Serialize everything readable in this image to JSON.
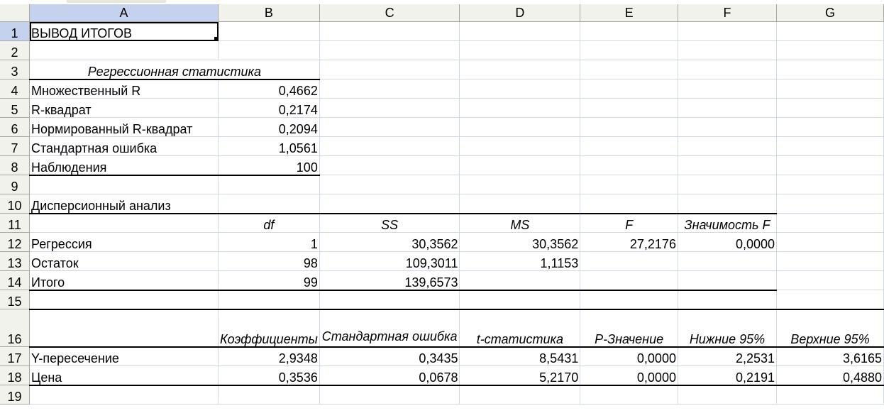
{
  "columns": [
    "A",
    "B",
    "C",
    "D",
    "E",
    "F",
    "G"
  ],
  "rows": [
    {
      "num": "1",
      "cells": [
        "ВЫВОД ИТОГОВ",
        "",
        "",
        "",
        "",
        "",
        ""
      ]
    },
    {
      "num": "2",
      "cells": [
        "",
        "",
        "",
        "",
        "",
        "",
        ""
      ]
    },
    {
      "num": "3",
      "cells": [
        "Регрессионная статистика",
        "",
        "",
        "",
        "",
        "",
        ""
      ]
    },
    {
      "num": "4",
      "cells": [
        "Множественный R",
        "0,4662",
        "",
        "",
        "",
        "",
        ""
      ]
    },
    {
      "num": "5",
      "cells": [
        "R-квадрат",
        "0,2174",
        "",
        "",
        "",
        "",
        ""
      ]
    },
    {
      "num": "6",
      "cells": [
        "Нормированный R-квадрат",
        "0,2094",
        "",
        "",
        "",
        "",
        ""
      ]
    },
    {
      "num": "7",
      "cells": [
        "Стандартная ошибка",
        "1,0561",
        "",
        "",
        "",
        "",
        ""
      ]
    },
    {
      "num": "8",
      "cells": [
        "Наблюдения",
        "100",
        "",
        "",
        "",
        "",
        ""
      ]
    },
    {
      "num": "9",
      "cells": [
        "",
        "",
        "",
        "",
        "",
        "",
        ""
      ]
    },
    {
      "num": "10",
      "cells": [
        "Дисперсионный анализ",
        "",
        "",
        "",
        "",
        "",
        ""
      ]
    },
    {
      "num": "11",
      "cells": [
        "",
        "df",
        "SS",
        "MS",
        "F",
        "Значимость F",
        ""
      ]
    },
    {
      "num": "12",
      "cells": [
        "Регрессия",
        "1",
        "30,3562",
        "30,3562",
        "27,2176",
        "0,0000",
        ""
      ]
    },
    {
      "num": "13",
      "cells": [
        "Остаток",
        "98",
        "109,3011",
        "1,1153",
        "",
        "",
        ""
      ]
    },
    {
      "num": "14",
      "cells": [
        "Итого",
        "99",
        "139,6573",
        "",
        "",
        "",
        ""
      ]
    },
    {
      "num": "15",
      "cells": [
        "",
        "",
        "",
        "",
        "",
        "",
        ""
      ]
    },
    {
      "num": "16",
      "cells": [
        "",
        "Коэффициенты",
        "Стандартная ошибка",
        "t-статистика",
        "P-Значение",
        "Нижние 95%",
        "Верхние 95%"
      ]
    },
    {
      "num": "17",
      "cells": [
        "Y-пересечение",
        "2,9348",
        "0,3435",
        "8,5431",
        "0,0000",
        "2,2531",
        "3,6165"
      ]
    },
    {
      "num": "18",
      "cells": [
        "Цена",
        "0,3536",
        "0,0678",
        "5,2170",
        "0,0000",
        "0,2191",
        "0,4880"
      ]
    },
    {
      "num": "19",
      "cells": [
        "",
        "",
        "",
        "",
        "",
        "",
        ""
      ]
    }
  ],
  "active_cell": "A1",
  "colors": {
    "header_bg": "#f2f2ec",
    "header_selected": "#c5d2ee",
    "gridline": "#d0d7e5"
  }
}
